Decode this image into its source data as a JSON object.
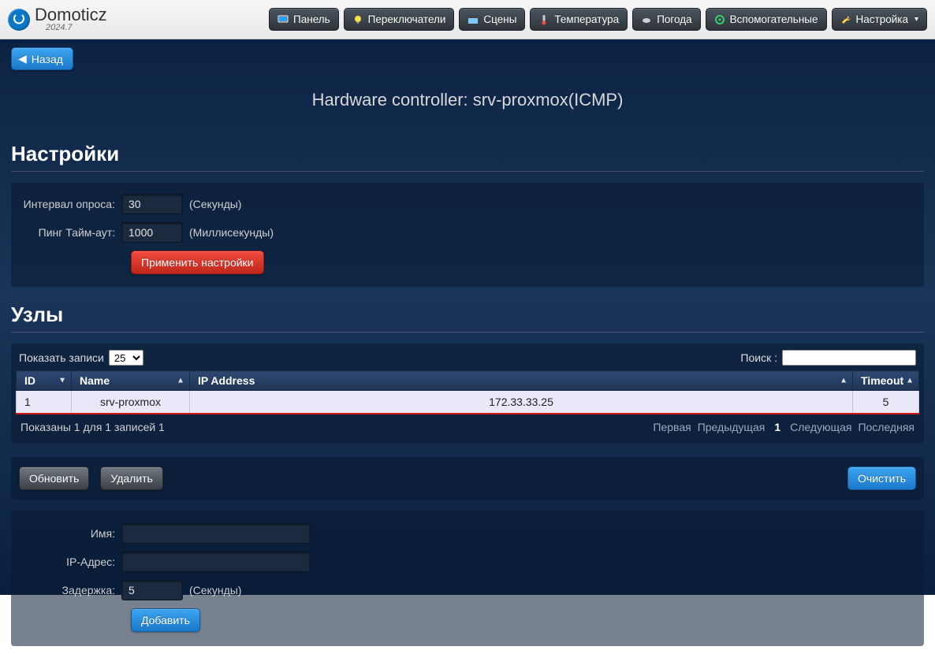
{
  "brand": {
    "name": "Domoticz",
    "version": "2024.7"
  },
  "nav": {
    "panel": "Панель",
    "switches": "Переключатели",
    "scenes": "Сцены",
    "temperature": "Температура",
    "weather": "Погода",
    "utility": "Вспомогательные",
    "setup": "Настройка"
  },
  "icons": {
    "panel_color": "#2aa0ff",
    "switch_color": "#ffe14a",
    "scene_color": "#7fc7ff",
    "temp_color": "#ff4848",
    "weather_color": "#d0d0d0",
    "utility_color": "#34d06a",
    "setup_color": "#ffd34a"
  },
  "back": {
    "label": "Назад"
  },
  "title": "Hardware controller: srv-proxmox(ICMP)",
  "settings": {
    "heading": "Настройки",
    "pollLabel": "Интервал опроса:",
    "pollValue": "30",
    "pollUnit": "(Секунды)",
    "timeoutLabel": "Пинг Тайм-аут:",
    "timeoutValue": "1000",
    "timeoutUnit": "(Миллисекунды)",
    "applyLabel": "Применить настройки"
  },
  "nodes": {
    "heading": "Узлы",
    "lengthLabel": "Показать записи",
    "lengthValue": "25",
    "searchLabel": "Поиск :",
    "columns": {
      "id": "ID",
      "name": "Name",
      "ip": "IP Address",
      "timeout": "Timeout"
    },
    "rows": [
      {
        "id": "1",
        "name": "srv-proxmox",
        "ip": "172.33.33.25",
        "timeout": "5"
      }
    ],
    "info": "Показаны 1 для 1 записей 1",
    "pager": {
      "first": "Первая",
      "prev": "Предыдущая",
      "page": "1",
      "next": "Следующая",
      "last": "Последняя"
    }
  },
  "crud": {
    "update": "Обновить",
    "delete": "Удалить",
    "clear": "Очистить"
  },
  "edit": {
    "nameLabel": "Имя:",
    "nameValue": "",
    "ipLabel": "IP-Адрес:",
    "ipValue": "",
    "delayLabel": "Задержка:",
    "delayValue": "5",
    "delayUnit": "(Секунды)",
    "addLabel": "Добавить"
  }
}
